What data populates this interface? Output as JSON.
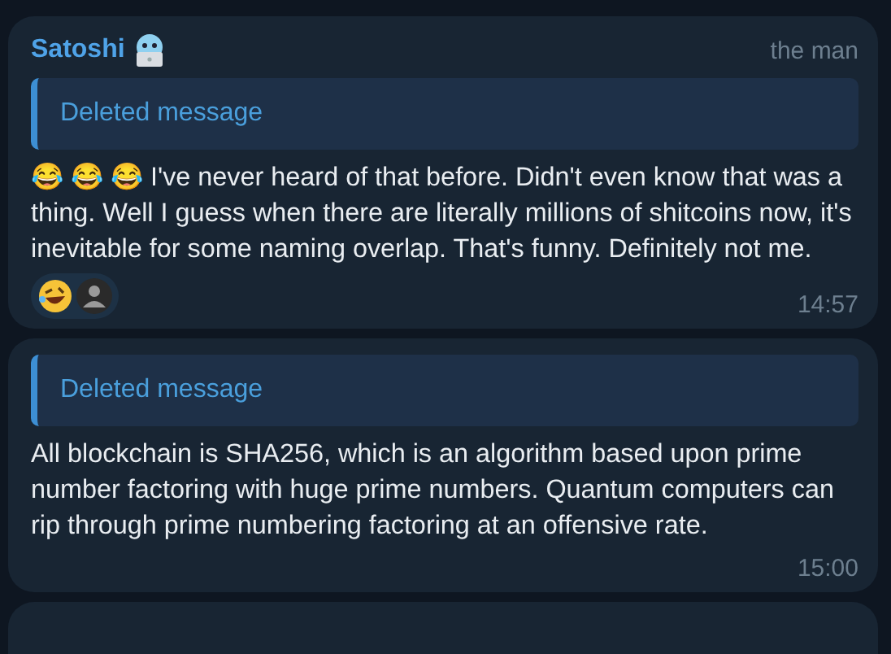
{
  "messages": [
    {
      "sender": "Satoshi",
      "sender_title": "the man",
      "reply": "Deleted message",
      "text": "😂 😂 😂 I've never heard of that before. Didn't even know that was a thing. Well I guess when there are literally millions of shitcoins now, it's inevitable for some naming overlap. That's funny. Definitely not me.",
      "reactions": [
        {
          "kind": "emoji"
        },
        {
          "kind": "avatar"
        }
      ],
      "time": "14:57"
    },
    {
      "reply": "Deleted message",
      "text": "All blockchain is SHA256, which is an algorithm based upon prime number factoring with huge prime numbers. Quantum computers can rip through prime numbering factoring at an offensive rate.",
      "time": "15:00"
    }
  ]
}
